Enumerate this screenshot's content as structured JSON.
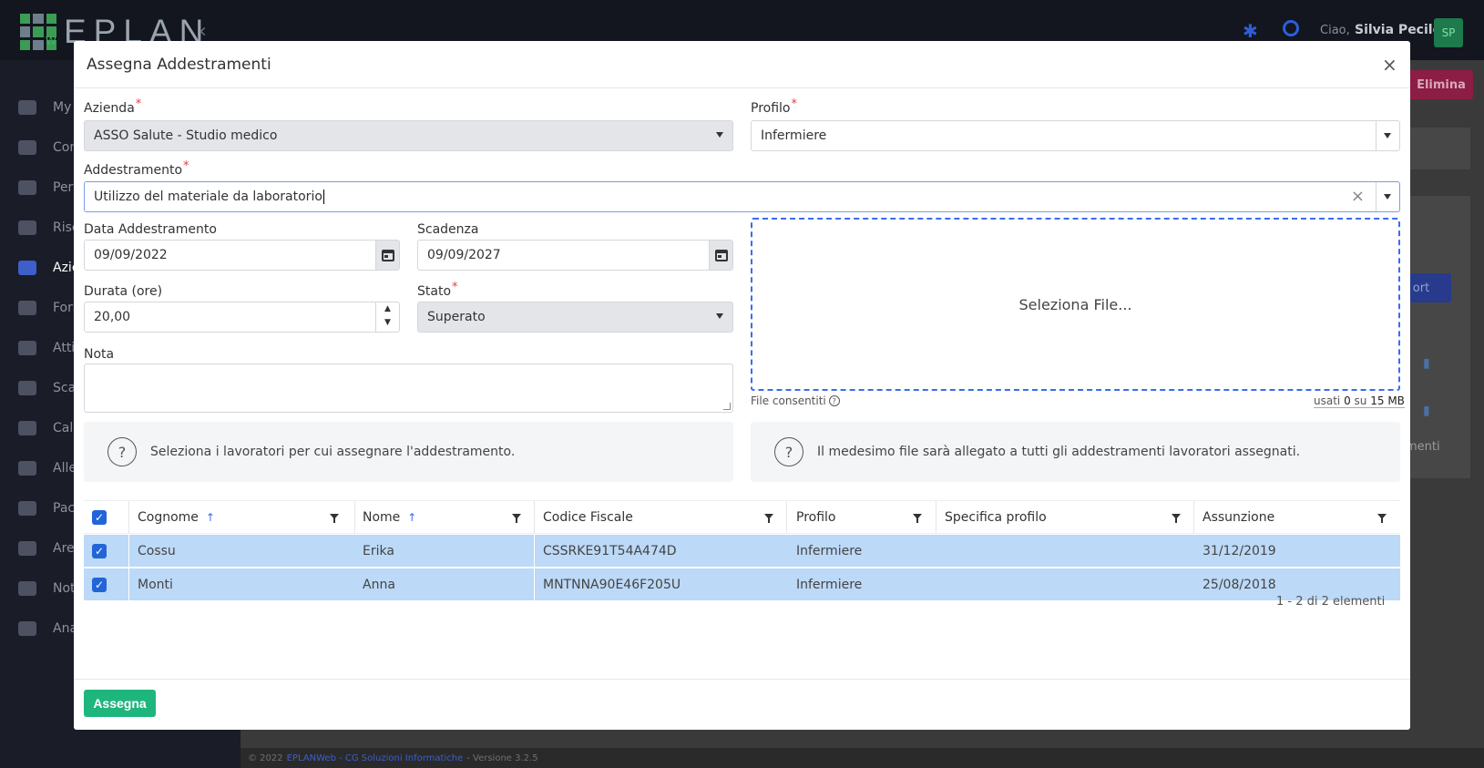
{
  "app": {
    "logo_text": "EPLAN",
    "logo_sub": "W",
    "greeting": "Ciao,",
    "user_name": "Silvia Pecile",
    "user_initials": "SP",
    "sidebar": [
      {
        "label": "My"
      },
      {
        "label": "Con"
      },
      {
        "label": "Pers"
      },
      {
        "label": "Risc"
      },
      {
        "label": "Azie"
      },
      {
        "label": "Forr"
      },
      {
        "label": "Atti"
      },
      {
        "label": "Sca"
      },
      {
        "label": "Cal"
      },
      {
        "label": "Alle"
      },
      {
        "label": "Pac"
      },
      {
        "label": "Are"
      },
      {
        "label": "Not"
      },
      {
        "label": "Ana"
      }
    ],
    "bg_delete_button": "Elimina",
    "bg_export_button": "ort",
    "bg_text": "menti",
    "footer_copyright": "© 2022",
    "footer_link": "EPLANWeb - CG Soluzioni Informatiche",
    "footer_version": "- Versione 3.2.5"
  },
  "modal": {
    "title": "Assegna Addestramenti",
    "close_label": "×",
    "azienda": {
      "label": "Azienda",
      "value": "ASSO Salute - Studio medico"
    },
    "profilo": {
      "label": "Profilo",
      "value": "Infermiere"
    },
    "addestramento": {
      "label": "Addestramento",
      "value": "Utilizzo del materiale da laboratorio"
    },
    "data_addestramento": {
      "label": "Data Addestramento",
      "value": "09/09/2022"
    },
    "scadenza": {
      "label": "Scadenza",
      "value": "09/09/2027"
    },
    "durata": {
      "label": "Durata (ore)",
      "value": "20,00"
    },
    "stato": {
      "label": "Stato",
      "value": "Superato"
    },
    "nota": {
      "label": "Nota",
      "value": ""
    },
    "dropzone_label": "Seleziona File...",
    "file_allowed_label": "File consentiti",
    "file_usage": {
      "prefix": "usati",
      "used": "0",
      "middle": "su",
      "max": "15 MB"
    },
    "info_workers": "Seleziona i lavoratori per cui assegnare l'addestramento.",
    "info_file": "Il medesimo file sarà allegato a tutti gli addestramenti lavoratori assegnati.",
    "grid": {
      "columns": [
        "Cognome",
        "Nome",
        "Codice Fiscale",
        "Profilo",
        "Specifica profilo",
        "Assunzione"
      ],
      "rows": [
        {
          "cognome": "Cossu",
          "nome": "Erika",
          "cf": "CSSRKE91T54A474D",
          "profilo": "Infermiere",
          "specifica": "",
          "assunzione": "31/12/2019"
        },
        {
          "cognome": "Monti",
          "nome": "Anna",
          "cf": "MNTNNA90E46F205U",
          "profilo": "Infermiere",
          "specifica": "",
          "assunzione": "25/08/2018"
        }
      ],
      "pager": "1 - 2 di 2 elementi"
    },
    "submit_label": "Assegna"
  },
  "colors": {
    "accent_blue": "#2165d9",
    "success_green": "#1fb67e",
    "row_selected": "#bcd9f7",
    "required_red": "#e53e3e"
  }
}
